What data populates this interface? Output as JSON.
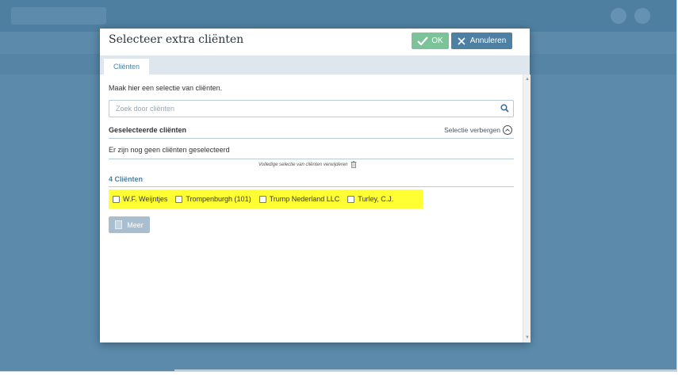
{
  "modal": {
    "title": "Selecteer extra cliënten",
    "ok_label": "OK",
    "cancel_label": "Annuleren",
    "tab_label": "Cliënten",
    "intro_text": "Maak hier een selectie van cliënten.",
    "search_placeholder": "Zoek door cliënten",
    "selected_title": "Geselecteerde cliënten",
    "toggle_label": "Selectie verbergen",
    "empty_text": "Er zijn nog geen cliënten geselecteerd",
    "remove_all_label": "Volledige selectie van cliënten verwijderen",
    "count_label": "4 Cliënten",
    "clients": [
      {
        "name": "W.F. Weijntjes",
        "checked": false
      },
      {
        "name": "Trompenburgh (101)",
        "checked": false
      },
      {
        "name": "Trump Nederland LLC",
        "checked": false
      },
      {
        "name": "Turley, C.J.",
        "checked": false
      }
    ],
    "more_label": "Meer"
  },
  "colors": {
    "primary": "#4d80a2",
    "ok_green": "#7cc39a",
    "highlight": "#ffff33",
    "overlay_bg": "#5b8aab"
  },
  "icons": {
    "ok": "checkmark-icon",
    "cancel": "close-icon",
    "search": "search-icon",
    "toggle": "chevron-up-icon",
    "remove": "trash-icon",
    "more": "document-icon"
  }
}
